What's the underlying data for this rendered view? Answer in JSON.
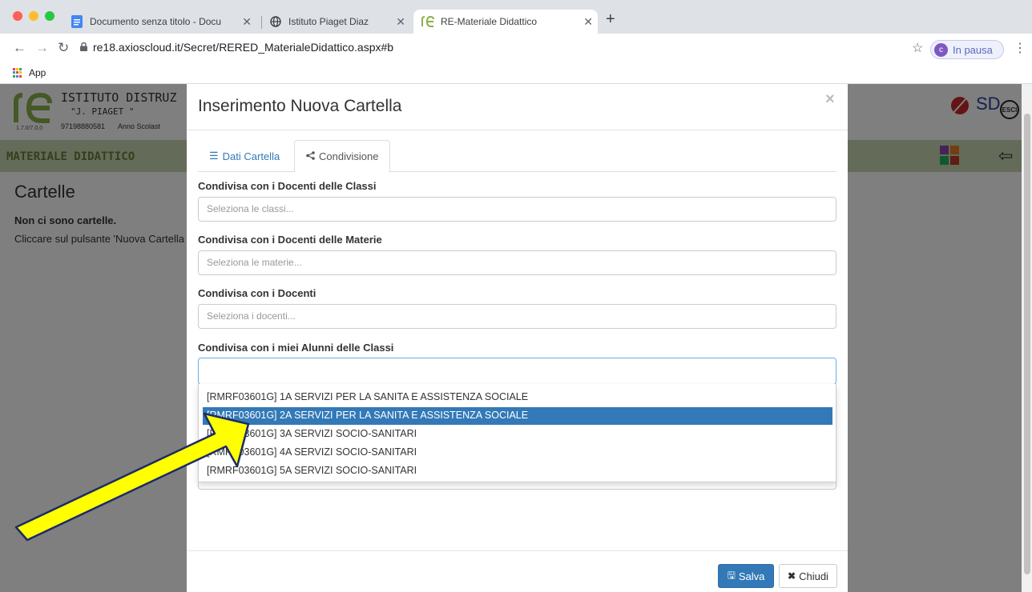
{
  "browser": {
    "tabs": [
      {
        "title": "Documento senza titolo - Docu",
        "icon": "docs-icon"
      },
      {
        "title": "Istituto Piaget Diaz",
        "icon": "globe-icon"
      },
      {
        "title": "RE-Materiale Didattico",
        "icon": "re-logo-icon"
      }
    ],
    "url": "re18.axioscloud.it/Secret/RERED_MaterialeDidattico.aspx#b",
    "profile_initial": "c",
    "profile_label": "In pausa",
    "bookmarks_app": "App"
  },
  "school": {
    "name": "ISTITUTO DISTRUZ",
    "sub": "\"J. PIAGET \"",
    "code": "97198880581",
    "year": "Anno Scolast",
    "version": "1.7.0/7.0.0",
    "section": "MATERIALE DIDATTICO",
    "sd_logo": "SD",
    "exit": "ESCI"
  },
  "page": {
    "title": "Cartelle",
    "empty": "Non ci sono cartelle.",
    "hint": "Cliccare sul pulsante 'Nuova Cartella"
  },
  "modal": {
    "title": "Inserimento Nuova Cartella",
    "close": "×",
    "tabs": [
      {
        "label": "Dati Cartella",
        "active": false
      },
      {
        "label": "Condivisione",
        "active": true
      }
    ],
    "fields": [
      {
        "label": "Condivisa con i Docenti delle Classi",
        "placeholder": "Seleziona le classi..."
      },
      {
        "label": "Condivisa con i Docenti delle Materie",
        "placeholder": "Seleziona le materie..."
      },
      {
        "label": "Condivisa con i Docenti",
        "placeholder": "Seleziona i docenti..."
      },
      {
        "label": "Condivisa con i miei Alunni delle Classi",
        "placeholder": ""
      }
    ],
    "options": [
      "[RMRF03601G] 1A SERVIZI PER LA SANITA E ASSISTENZA SOCIALE",
      "[RMRF03601G] 2A SERVIZI PER LA SANITA E ASSISTENZA SOCIALE",
      "[RMRF03601G] 3A SERVIZI SOCIO-SANITARI",
      "[RMRF03601G] 4A SERVIZI SOCIO-SANITARI",
      "[RMRF03601G] 5A SERVIZI SOCIO-SANITARI"
    ],
    "highlighted_option": 1,
    "save": "Salva",
    "cancel": "Chiudi"
  },
  "colors": {
    "primary": "#3379b7",
    "header_green": "#c9d7b3",
    "annotation_arrow": "#ffff00"
  }
}
